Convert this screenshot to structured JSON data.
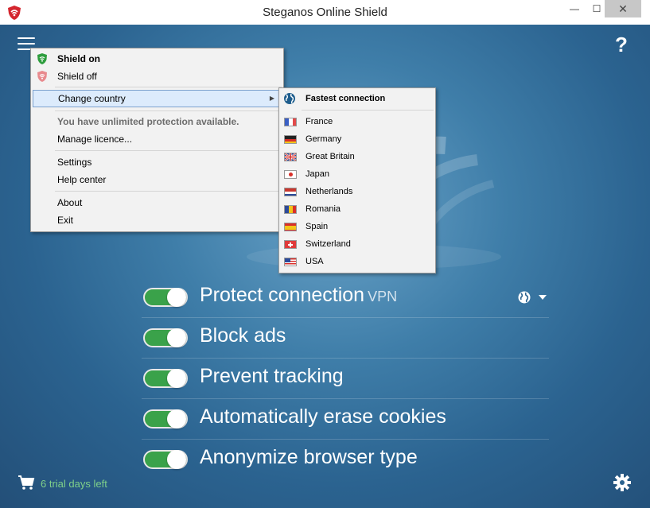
{
  "window": {
    "title": "Steganos Online Shield",
    "minimize_glyph": "—",
    "maximize_glyph": "☐",
    "close_glyph": "✕"
  },
  "main": {
    "help_glyph": "?",
    "toggles": [
      {
        "label": "Protect connection",
        "suffix": "VPN",
        "on": true
      },
      {
        "label": "Block ads",
        "on": true
      },
      {
        "label": "Prevent tracking",
        "on": true
      },
      {
        "label": "Automatically erase cookies",
        "on": true
      },
      {
        "label": "Anonymize browser type",
        "on": true
      }
    ],
    "trial_text": "6 trial days left"
  },
  "menu": {
    "shield_on": "Shield on",
    "shield_off": "Shield off",
    "change_country": "Change country",
    "unlimited": "You have unlimited protection available.",
    "manage_licence": "Manage licence...",
    "settings": "Settings",
    "help_center": "Help center",
    "about": "About",
    "exit": "Exit"
  },
  "countries": {
    "fastest": "Fastest connection",
    "items": [
      "France",
      "Germany",
      "Great Britain",
      "Japan",
      "Netherlands",
      "Romania",
      "Spain",
      "Switzerland",
      "USA"
    ]
  },
  "colors": {
    "toggle_on": "#3aa24a",
    "trial_text": "#7fd08a",
    "brand_red": "#d4262e",
    "shield_green": "#2e9d3e"
  },
  "icons": [
    "app-logo-icon",
    "hamburger-icon",
    "help-icon",
    "globe-icon",
    "cart-icon",
    "gear-icon",
    "shield-icon"
  ]
}
